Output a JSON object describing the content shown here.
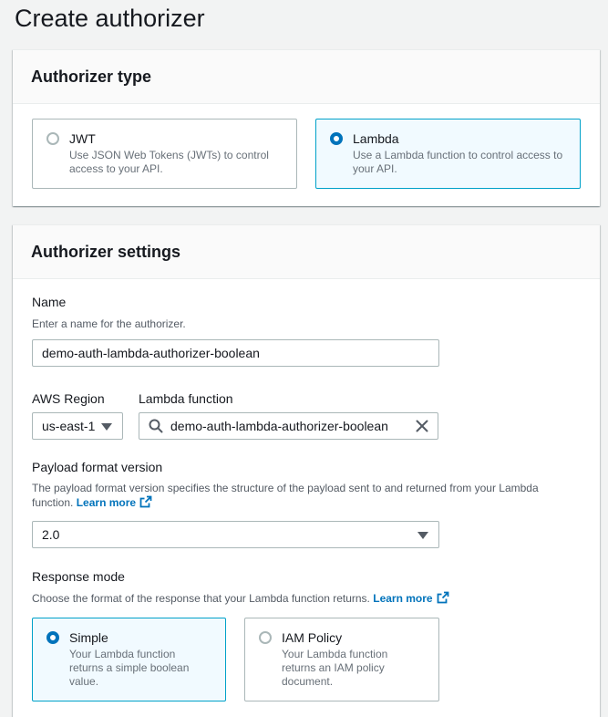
{
  "page": {
    "title": "Create authorizer"
  },
  "authorizer_type": {
    "heading": "Authorizer type",
    "options": [
      {
        "title": "JWT",
        "desc_line1": "Use JSON Web Tokens (JWTs) to control",
        "desc_line2": "access to your API.",
        "selected": false
      },
      {
        "title": "Lambda",
        "desc_line1": "Use a Lambda function to control access to",
        "desc_line2": "your API.",
        "selected": true
      }
    ]
  },
  "settings": {
    "heading": "Authorizer settings",
    "name": {
      "label": "Name",
      "description": "Enter a name for the authorizer.",
      "value": "demo-auth-lambda-authorizer-boolean"
    },
    "region": {
      "label": "AWS Region",
      "value": "us-east-1"
    },
    "lambda_function": {
      "label": "Lambda function",
      "value": "demo-auth-lambda-authorizer-boolean"
    },
    "payload": {
      "label": "Payload format version",
      "description_line1": "The payload format version specifies the structure of the payload sent to and returned from your Lambda",
      "description_line2": "function.",
      "learn_more": "Learn more",
      "value": "2.0"
    },
    "response_mode": {
      "label": "Response mode",
      "description": "Choose the format of the response that your Lambda function returns.",
      "learn_more": "Learn more",
      "options": [
        {
          "title": "Simple",
          "desc_line1": "Your Lambda function",
          "desc_line2": "returns a simple boolean",
          "desc_line3": "value.",
          "selected": true
        },
        {
          "title": "IAM Policy",
          "desc_line1": "Your Lambda function",
          "desc_line2": "returns an IAM policy",
          "desc_line3": "document.",
          "selected": false
        }
      ]
    }
  },
  "colors": {
    "accent": "#0073bb",
    "selected_border": "#00a1c9",
    "selected_bg": "#f1faff"
  }
}
